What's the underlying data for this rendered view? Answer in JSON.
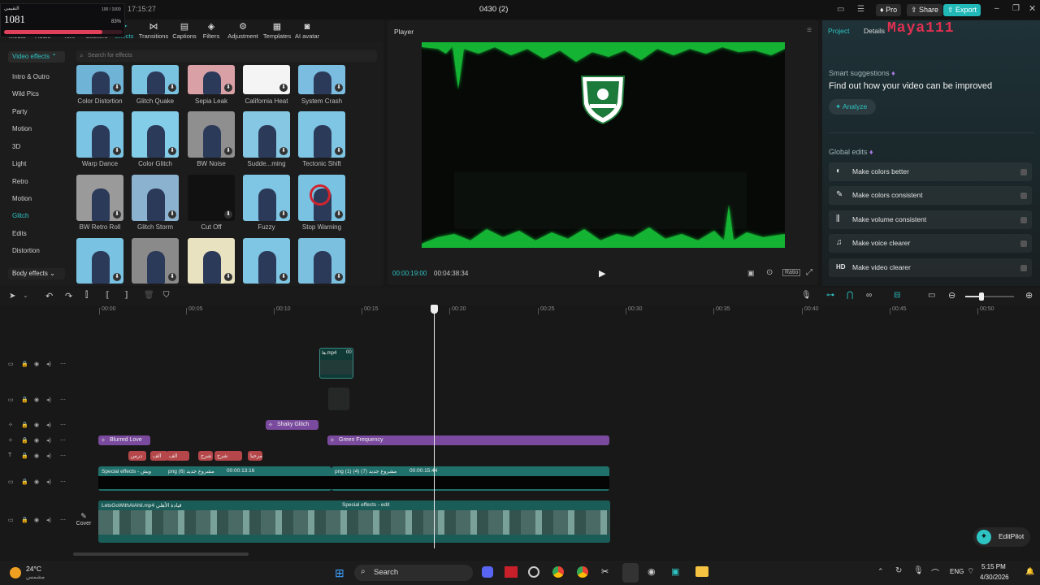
{
  "overlay": {
    "name": "التقيمي",
    "score": "1081",
    "stat": "100 / 1000",
    "pct": "83%"
  },
  "titlebar": {
    "time": "17:15:27",
    "title": "0430 (2)",
    "pro": "Pro",
    "share": "Share",
    "export": "Export"
  },
  "tools": [
    {
      "label": "Media"
    },
    {
      "label": "Audio"
    },
    {
      "label": "Text"
    },
    {
      "label": "Stickers"
    },
    {
      "label": "Effects"
    },
    {
      "label": "Transitions"
    },
    {
      "label": "Captions"
    },
    {
      "label": "Filters"
    },
    {
      "label": "Adjustment"
    },
    {
      "label": "Templates"
    },
    {
      "label": "AI avatar"
    }
  ],
  "sidebar": {
    "video_effects": "Video effects",
    "items": [
      "Intro & Outro",
      "Wild Pics",
      "Party",
      "Motion",
      "3D",
      "Light",
      "Retro",
      "Motion",
      "Glitch",
      "Edits",
      "Distortion"
    ],
    "body_effects": "Body effects"
  },
  "search": {
    "placeholder": "Search for effects"
  },
  "effects": [
    [
      "Color Distortion",
      "Glitch Quake",
      "Sepia Leak",
      "California Heat",
      "System Crash"
    ],
    [
      "Warp Dance",
      "Color Glitch",
      "BW Noise",
      "Sudde...ming",
      "Tectonic Shift"
    ],
    [
      "BW Retro Roll",
      "Glitch Storm",
      "Cut Off",
      "Fuzzy",
      "Stop Warning"
    ]
  ],
  "player": {
    "title": "Player",
    "current": "00:00:19:00",
    "total": "00:04:38:34",
    "ratio": "Ratio"
  },
  "rightpanel": {
    "tab_project": "Project",
    "tab_details": "Details",
    "watermark": "Maya111",
    "smart_title": "Smart suggestions",
    "smart_sub": "Find out how your video can be improved",
    "analyze": "Analyze",
    "global": "Global edits",
    "edits": [
      "Make colors better",
      "Make colors consistent",
      "Make volume consistent",
      "Make voice clearer",
      "Make video clearer"
    ]
  },
  "ruler": [
    "00:00",
    "00:05",
    "00:10",
    "00:15",
    "00:20",
    "00:25",
    "00:30",
    "00:35",
    "00:40",
    "00:45",
    "00:50"
  ],
  "clips": {
    "small_video": "ها.mp4",
    "small_video_time": "00",
    "shaky": "Shaky Glitch",
    "blurred": "Blurred Love",
    "green": "Green Frequency",
    "text_chips": [
      "درس",
      "الف",
      "الف",
      "شرح",
      "شرح",
      "مرحبا"
    ],
    "special1": "Special effects - ويش",
    "special1_file": "png (6) مشروع جديد",
    "special1_time": "00:00:13:16",
    "special2_file": "png (1) (4) (7) مشروع جديد",
    "special2_time": "00:00:15:44",
    "main_clip": "LetsGoWithAlAhli.mp4 قيادة الأهلي",
    "main_special": "Special effects - edit",
    "cover": "Cover"
  },
  "editpilot": "EditPilot",
  "taskbar": {
    "weather_temp": "24°C",
    "weather_desc": "مشمس",
    "search": "Search",
    "lang": "ENG",
    "time": "5:15 PM",
    "date": "4/30/2026"
  },
  "colors": {
    "accent": "#2ec4c4",
    "effect": "#7a4a9e",
    "text_chip": "#b5474a",
    "clip": "#1f6f6a",
    "progress": "#e0405a"
  }
}
